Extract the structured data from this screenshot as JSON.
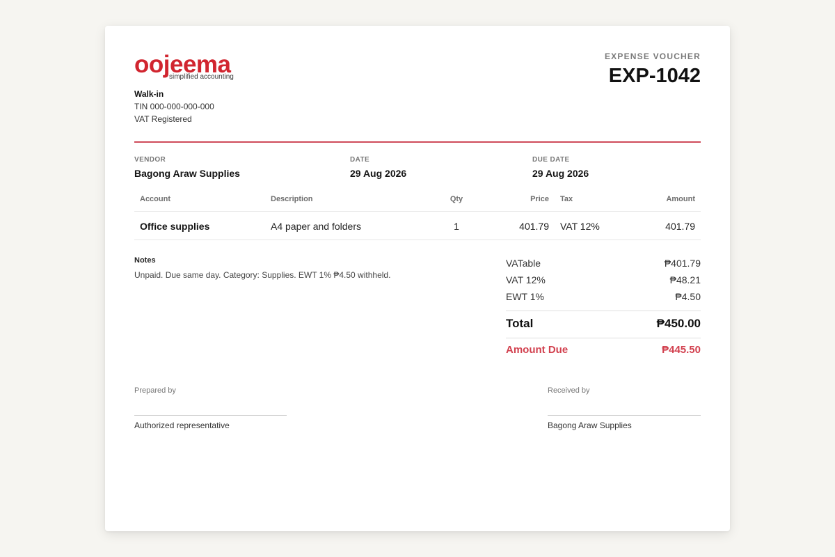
{
  "company": {
    "logo_text": "oojeema",
    "logo_tagline": "simplified accounting",
    "name": "Walk-in",
    "tin": "TIN 000-000-000-000",
    "vat_status": "VAT Registered"
  },
  "document": {
    "type": "EXPENSE VOUCHER",
    "number": "EXP-1042"
  },
  "meta": {
    "vendor_label": "VENDOR",
    "vendor": "Bagong Araw Supplies",
    "date_label": "DATE",
    "date": "29 Aug 2026",
    "due_label": "DUE DATE",
    "due_date": "29 Aug 2026"
  },
  "table": {
    "headers": {
      "account": "Account",
      "description": "Description",
      "qty": "Qty",
      "price": "Price",
      "tax": "Tax",
      "amount": "Amount"
    },
    "rows": [
      {
        "account": "Office supplies",
        "description": "A4 paper and folders",
        "qty": "1",
        "price": "401.79",
        "tax": "VAT 12%",
        "amount": "401.79"
      }
    ]
  },
  "notes": {
    "title": "Notes",
    "text": "Unpaid. Due same day. Category: Supplies. EWT 1% ₱4.50 withheld."
  },
  "totals": {
    "vatable_label": "VATable",
    "vatable": "₱401.79",
    "vat_label": "VAT 12%",
    "vat": "₱48.21",
    "ewt_label": "EWT 1%",
    "ewt": "₱4.50",
    "total_label": "Total",
    "total": "₱450.00",
    "due_label": "Amount Due",
    "due": "₱445.50"
  },
  "signatures": {
    "prepared_label": "Prepared by",
    "prepared_name": "Authorized representative",
    "received_label": "Received by",
    "received_name": "Bagong Araw Supplies"
  },
  "colors": {
    "brand": "#d1252f",
    "accent_line": "#cf4b5a",
    "amount_due": "#d2414f"
  }
}
